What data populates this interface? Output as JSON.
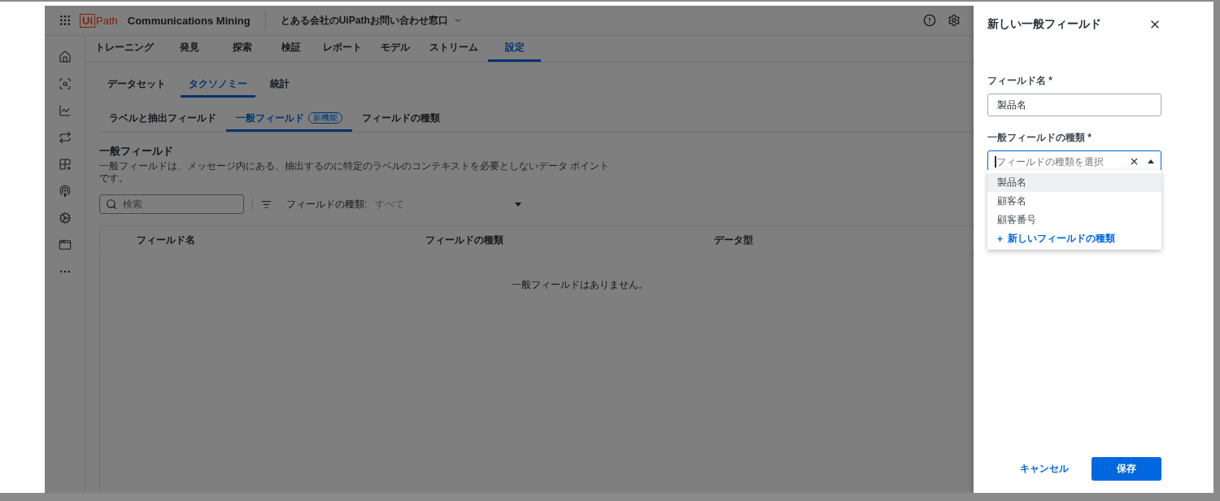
{
  "app_bar": {
    "logo_mark": "Ui",
    "logo_rest": "Path",
    "product": "Communications Mining",
    "workspace": "とある会社のUiPathお問い合わせ窓口"
  },
  "nav_tabs": [
    {
      "label": "トレーニング",
      "selected": false
    },
    {
      "label": "発見",
      "selected": false
    },
    {
      "label": "探索",
      "selected": false
    },
    {
      "label": "検証",
      "selected": false
    },
    {
      "label": "レポート",
      "selected": false
    },
    {
      "label": "モデル",
      "selected": false
    },
    {
      "label": "ストリーム",
      "selected": false
    },
    {
      "label": "設定",
      "selected": true
    }
  ],
  "sub_tabs": [
    {
      "label": "データセット",
      "selected": false
    },
    {
      "label": "タクソノミー",
      "selected": true
    },
    {
      "label": "統計",
      "selected": false
    }
  ],
  "field_tabs": [
    {
      "label": "ラベルと抽出フィールド",
      "selected": false
    },
    {
      "label": "一般フィールド",
      "selected": true,
      "badge": "新機能"
    },
    {
      "label": "フィールドの種類",
      "selected": false
    }
  ],
  "section": {
    "title": "一般フィールド",
    "description": "一般フィールドは、メッセージ内にある、抽出するのに特定のラベルのコンテキストを必要としないデータ ポイントです。"
  },
  "search": {
    "placeholder": "検索"
  },
  "filter": {
    "label": "フィールドの種類:",
    "value": "すべて"
  },
  "table": {
    "columns": [
      "フィールド名",
      "フィールドの種類",
      "データ型"
    ],
    "empty_message": "一般フィールドはありません。"
  },
  "drawer": {
    "title": "新しい一般フィールド",
    "name_field": {
      "label": "フィールド名 *",
      "value": "製品名"
    },
    "type_field": {
      "label": "一般フィールドの種類 *",
      "placeholder": "フィールドの種類を選択",
      "focused": true,
      "expanded": true,
      "options": [
        {
          "label": "製品名",
          "selected": true
        },
        {
          "label": "顧客名",
          "selected": false
        },
        {
          "label": "顧客番号",
          "selected": false
        }
      ],
      "add_option": {
        "icon": "+",
        "label": "新しいフィールドの種類"
      }
    },
    "cancel": "キャンセル",
    "save": "保存"
  }
}
